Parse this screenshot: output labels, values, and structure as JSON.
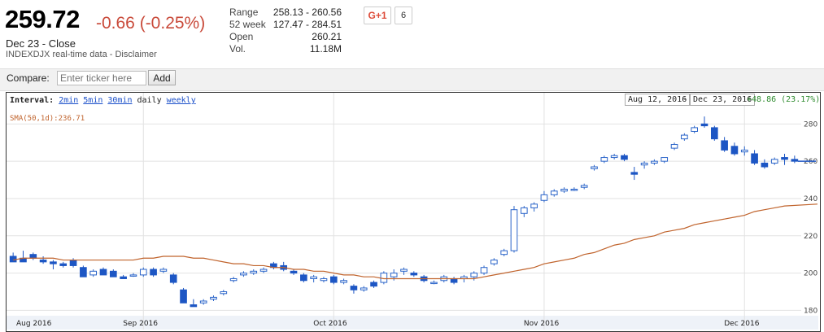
{
  "quote": {
    "price": "259.72",
    "change": "-0.66 (-0.25%)",
    "close_label": "Dec 23 - Close",
    "source": "INDEXDJX real-time data - Disclaimer"
  },
  "stats": [
    {
      "label": "Range",
      "value": "258.13 - 260.56"
    },
    {
      "label": "52 week",
      "value": "127.47 - 284.51"
    },
    {
      "label": "Open",
      "value": "260.21"
    },
    {
      "label": "Vol.",
      "value": "11.18M"
    }
  ],
  "social": {
    "gplus_label": "G+1",
    "count": "6"
  },
  "compare": {
    "label": "Compare:",
    "placeholder": "Enter ticker here",
    "add_label": "Add"
  },
  "interval": {
    "label": "Interval:",
    "opt_2min": "2min",
    "opt_5min": "5min",
    "opt_30min": "30min",
    "opt_daily": "daily",
    "opt_weekly": "weekly"
  },
  "range": {
    "start": "Aug 12, 2016",
    "sep": "-",
    "end": "Dec 23, 2016",
    "perf": "+48.86 (23.17%)"
  },
  "sma_label": "SMA(50,1d):236.71",
  "colors": {
    "up": "#2a64c9",
    "down": "#1d56c4",
    "sma": "#c0632c",
    "negative": "#c94a3a",
    "positive": "#2e8b2e"
  },
  "chart_data": {
    "type": "candlestick",
    "y_ticks": [
      180,
      200,
      220,
      240,
      260,
      280
    ],
    "ylim": [
      178,
      288
    ],
    "x_labels": [
      "Aug 2016",
      "Sep 2016",
      "Oct 2016",
      "Nov 2016",
      "Dec 2016"
    ],
    "x_label_index": [
      -1,
      13,
      32,
      53,
      73
    ],
    "candles": [
      [
        209,
        211,
        207,
        206
      ],
      [
        208,
        212,
        207,
        206
      ],
      [
        210,
        211,
        207,
        208
      ],
      [
        207,
        209,
        205,
        206
      ],
      [
        206,
        207,
        202,
        205
      ],
      [
        205,
        206,
        203,
        204
      ],
      [
        207,
        208,
        203,
        204
      ],
      [
        203,
        204,
        199,
        198
      ],
      [
        199,
        202,
        198,
        201
      ],
      [
        202,
        203,
        199,
        199
      ],
      [
        201,
        202,
        198,
        198
      ],
      [
        198,
        199,
        197,
        197
      ],
      [
        199,
        200,
        198,
        199
      ],
      [
        199,
        203,
        198,
        202
      ],
      [
        202,
        203,
        198,
        199
      ],
      [
        201,
        203,
        200,
        202
      ],
      [
        199,
        200,
        194,
        195
      ],
      [
        191,
        192,
        185,
        184
      ],
      [
        183,
        186,
        182,
        182
      ],
      [
        184,
        186,
        183,
        185
      ],
      [
        186,
        188,
        185,
        187
      ],
      [
        189,
        191,
        188,
        190
      ],
      [
        196,
        198,
        195,
        197
      ],
      [
        199,
        201,
        198,
        200
      ],
      [
        200,
        202,
        199,
        201
      ],
      [
        201,
        203,
        200,
        202
      ],
      [
        205,
        206,
        202,
        203
      ],
      [
        204,
        206,
        201,
        202
      ],
      [
        201,
        202,
        199,
        200
      ],
      [
        199,
        200,
        195,
        196
      ],
      [
        197,
        199,
        195,
        198
      ],
      [
        196,
        198,
        195,
        197
      ],
      [
        198,
        199,
        194,
        195
      ],
      [
        195,
        197,
        194,
        196
      ],
      [
        193,
        194,
        189,
        191
      ],
      [
        191,
        193,
        190,
        192
      ],
      [
        195,
        196,
        192,
        193
      ],
      [
        195,
        201,
        194,
        200
      ],
      [
        198,
        202,
        196,
        200
      ],
      [
        201,
        203,
        199,
        202
      ],
      [
        200,
        201,
        198,
        199
      ],
      [
        198,
        199,
        195,
        196
      ],
      [
        195,
        196,
        194,
        195
      ],
      [
        196,
        199,
        195,
        198
      ],
      [
        197,
        198,
        194,
        195
      ],
      [
        197,
        199,
        195,
        198
      ],
      [
        198,
        201,
        196,
        200
      ],
      [
        200,
        204,
        199,
        203
      ],
      [
        205,
        208,
        204,
        207
      ],
      [
        210,
        213,
        209,
        212
      ],
      [
        212,
        236,
        211,
        234
      ],
      [
        232,
        236,
        230,
        235
      ],
      [
        235,
        238,
        233,
        237
      ],
      [
        239,
        244,
        238,
        242
      ],
      [
        242,
        245,
        241,
        244
      ],
      [
        244,
        246,
        243,
        245
      ],
      [
        245,
        246,
        244,
        245
      ],
      [
        246,
        248,
        245,
        247
      ],
      [
        256,
        258,
        255,
        257
      ],
      [
        260,
        263,
        259,
        262
      ],
      [
        262,
        264,
        261,
        263
      ],
      [
        263,
        264,
        260,
        261
      ],
      [
        254,
        257,
        250,
        253
      ],
      [
        258,
        260,
        256,
        259
      ],
      [
        259,
        261,
        258,
        260
      ],
      [
        260,
        262,
        259,
        262
      ],
      [
        267,
        270,
        266,
        269
      ],
      [
        272,
        275,
        271,
        274
      ],
      [
        276,
        279,
        275,
        278
      ],
      [
        280,
        284,
        278,
        279
      ],
      [
        278,
        279,
        271,
        272
      ],
      [
        271,
        273,
        265,
        266
      ],
      [
        268,
        270,
        263,
        264
      ],
      [
        265,
        268,
        263,
        266
      ],
      [
        264,
        266,
        258,
        259
      ],
      [
        259,
        261,
        256,
        257
      ],
      [
        259,
        262,
        258,
        261
      ],
      [
        262,
        264,
        258,
        261
      ],
      [
        261,
        263,
        259,
        260
      ]
    ],
    "sma": [
      207,
      208,
      208,
      208,
      208,
      207,
      207,
      207,
      207,
      207,
      207,
      207,
      207,
      208,
      208,
      209,
      209,
      209,
      208,
      208,
      207,
      206,
      205,
      205,
      204,
      204,
      203,
      203,
      202,
      202,
      201,
      201,
      200,
      199,
      199,
      198,
      198,
      197,
      197,
      197,
      197,
      197,
      197,
      197,
      197,
      197,
      197,
      198,
      199,
      200,
      201,
      202,
      203,
      205,
      206,
      207,
      208,
      210,
      211,
      213,
      215,
      216,
      218,
      219,
      220,
      222,
      223,
      224,
      226,
      227,
      228,
      229,
      230,
      231,
      233,
      234,
      235,
      236,
      237
    ]
  }
}
